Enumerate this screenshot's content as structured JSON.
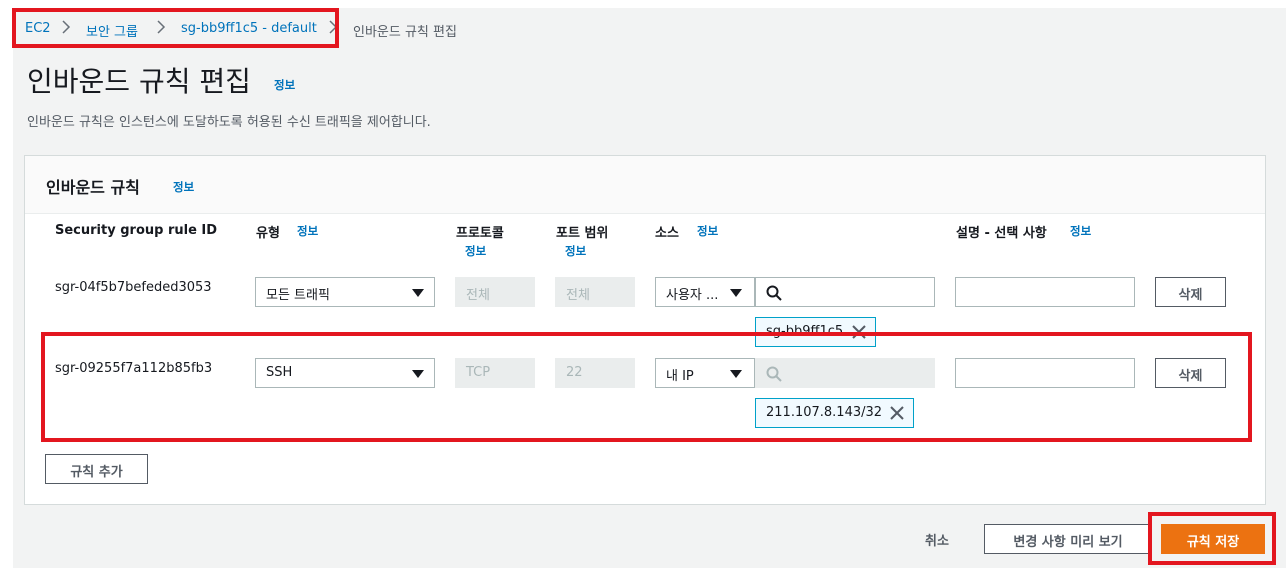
{
  "breadcrumb": {
    "items": [
      "EC2",
      "보안 그룹",
      "sg-bb9ff1c5 - default"
    ],
    "current": "인바운드 규칙 편집"
  },
  "page": {
    "title": "인바운드 규칙 편집",
    "info": "정보",
    "description": "인바운드 규칙은 인스턴스에 도달하도록 허용된 수신 트래픽을 제어합니다."
  },
  "panel": {
    "title": "인바운드 규칙",
    "info": "정보"
  },
  "columns": {
    "rule_id": "Security group rule ID",
    "type": "유형",
    "protocol": "프로토콜",
    "port_range": "포트 범위",
    "source": "소스",
    "description": "설명 - 선택 사항",
    "info": "정보"
  },
  "rules": [
    {
      "id": "sgr-04f5b7befeded3053",
      "type": "모든 트래픽",
      "protocol": "전체",
      "port": "전체",
      "source_type": "사용자 ...",
      "source_search": "",
      "source_token": "sg-bb9ff1c5",
      "description": "",
      "delete": "삭제"
    },
    {
      "id": "sgr-09255f7a112b85fb3",
      "type": "SSH",
      "protocol": "TCP",
      "port": "22",
      "source_type": "내 IP",
      "source_search": "",
      "source_token": "211.107.8.143/32",
      "description": "",
      "delete": "삭제"
    }
  ],
  "buttons": {
    "add_rule": "규칙 추가",
    "cancel": "취소",
    "preview": "변경 사항 미리 보기",
    "save": "규칙 저장"
  },
  "colors": {
    "highlight": "#e3161f",
    "primary": "#ec7211",
    "link": "#0073bb"
  }
}
